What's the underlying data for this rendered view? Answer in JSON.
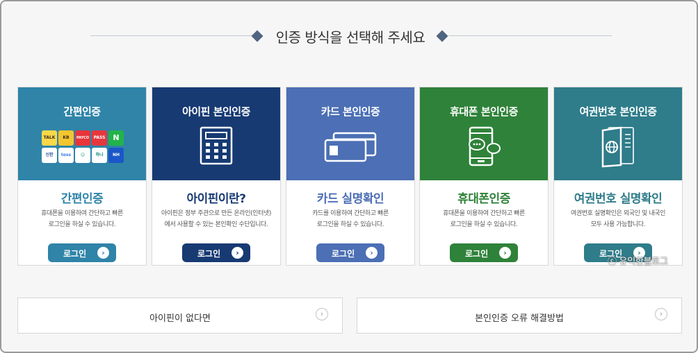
{
  "header": {
    "title": "인증 방식을 선택해 주세요"
  },
  "colors": {
    "simple": "#2f84a8",
    "ipin": "#173a73",
    "card": "#4c6fb5",
    "phone": "#2f8239",
    "passport": "#2f7c8a"
  },
  "cards": [
    {
      "title": "간편인증",
      "icon": "simple-auth-app-icons",
      "subtitle": "간편인증",
      "desc_line1": "휴대폰을 이용하여 간단하고 빠른",
      "desc_line2": "로그인을 하실 수 있습니다.",
      "button": "로그인",
      "app_badges": [
        "TALK",
        "KB",
        "PAYCO",
        "PASS",
        "N",
        "신한",
        "toss",
        "하나",
        "NH"
      ]
    },
    {
      "title": "아이핀 본인인증",
      "icon": "calculator-icon",
      "subtitle": "아이핀이란?",
      "desc_line1": "아이핀은 정부 주관으로 만든 온라인(인터넷)",
      "desc_line2": "에서 사용할 수 있는 본인확인 수단입니다.",
      "button": "로그인"
    },
    {
      "title": "카드 본인인증",
      "icon": "credit-card-icon",
      "subtitle": "카드 실명확인",
      "desc_line1": "카드를 이용하여 간단하고 빠른",
      "desc_line2": "로그인을 하실 수 있습니다.",
      "button": "로그인"
    },
    {
      "title": "휴대폰 본인인증",
      "icon": "mobile-phone-icon",
      "subtitle": "휴대폰인증",
      "desc_line1": "휴대폰을 이용하여 간단하고 빠른",
      "desc_line2": "로그인을 하실 수 있습니다.",
      "button": "로그인"
    },
    {
      "title": "여권번호 본인인증",
      "icon": "passport-icon",
      "subtitle": "여권번호 실명확인",
      "desc_line1": "여권번호 실명확인은 외국인 및 내국인",
      "desc_line2": "모두 사용 가능합니다.",
      "button": "로그인"
    }
  ],
  "links": {
    "no_ipin": "아이핀이 없다면",
    "error_help": "본인인증 오류 해결방법"
  },
  "watermark": "ⓒ 유익한블로그"
}
